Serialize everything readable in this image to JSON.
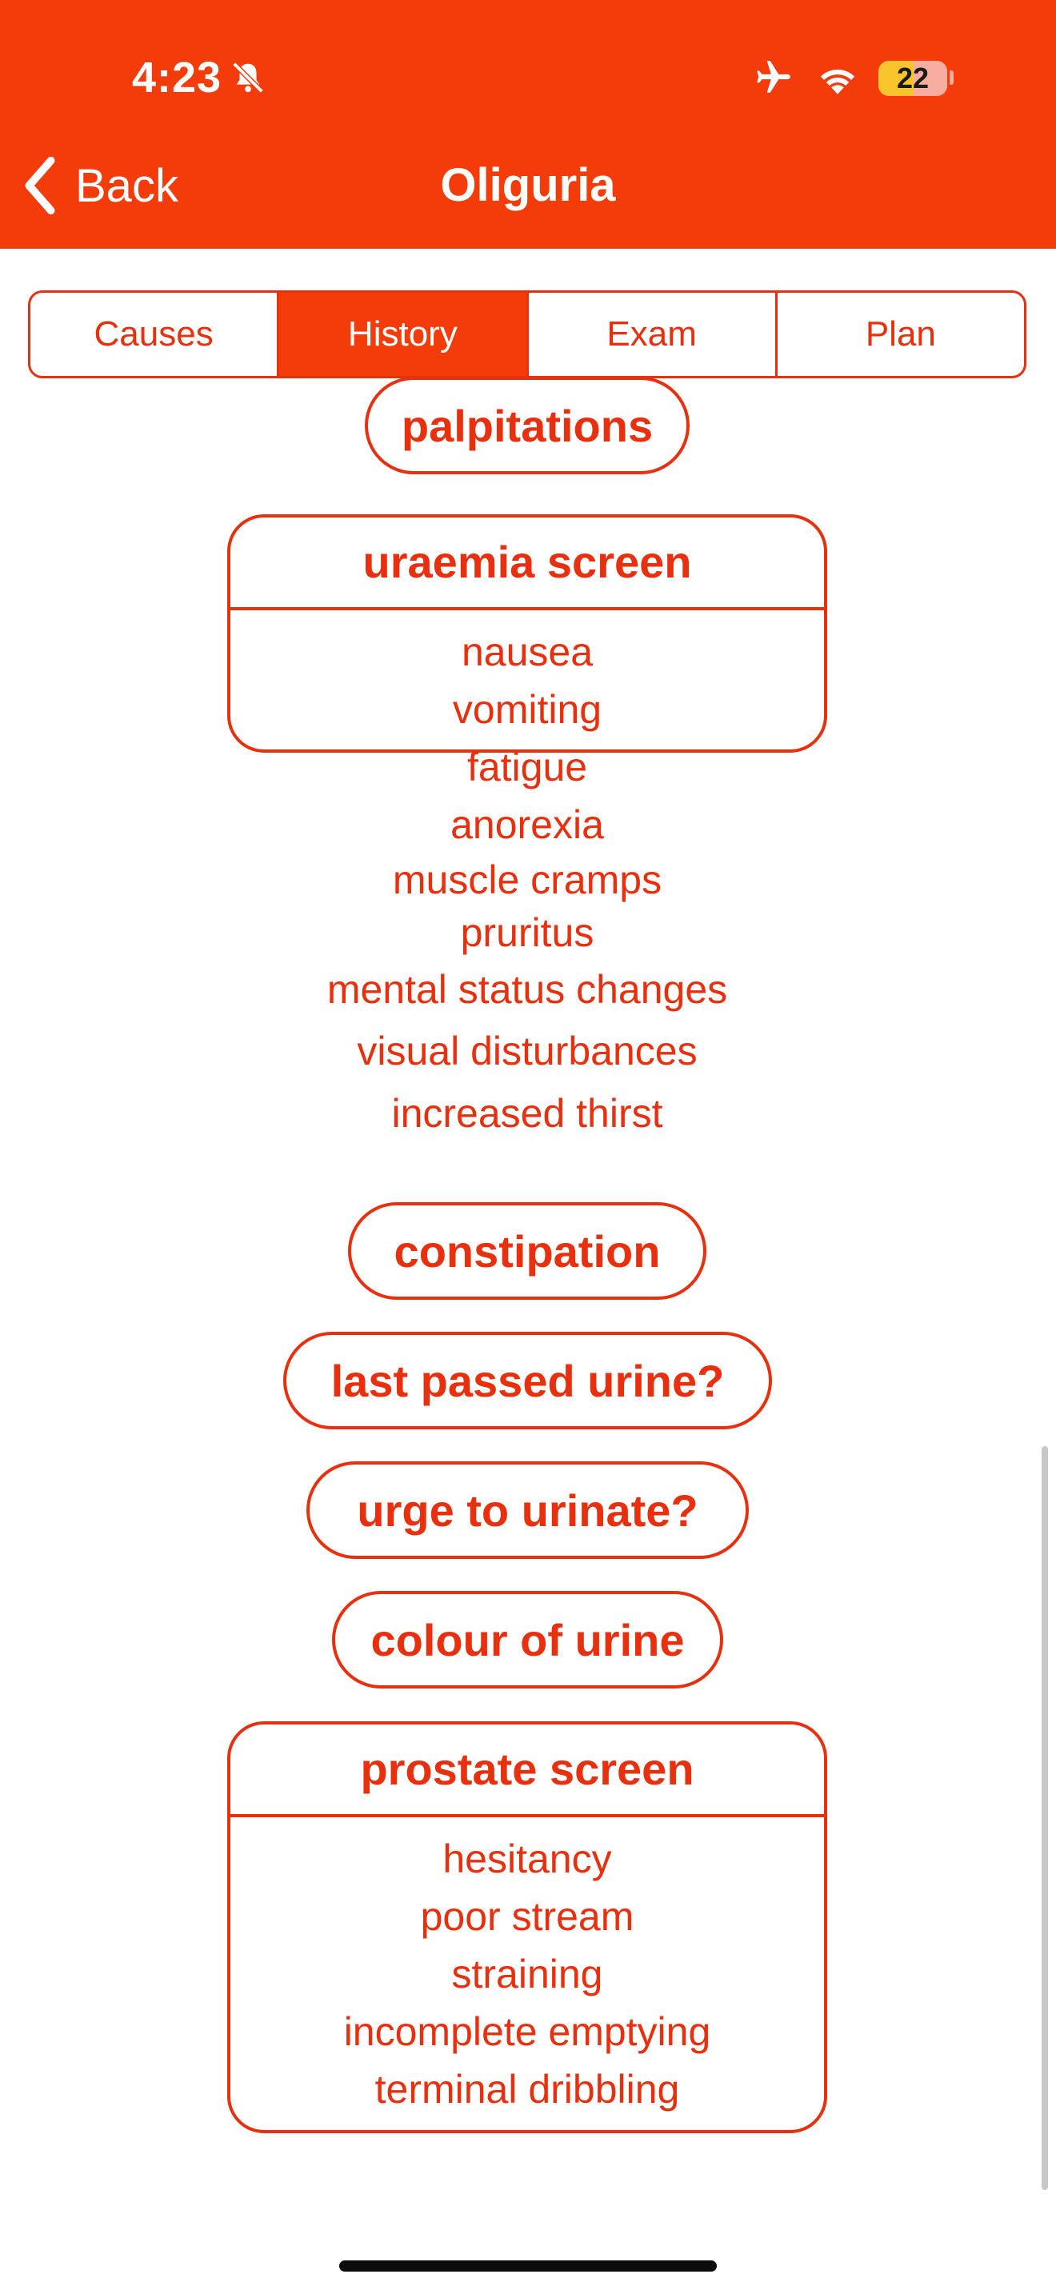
{
  "status_bar": {
    "time": "4:23",
    "battery": "22",
    "icons": [
      "bell-slash-icon",
      "airplane-icon",
      "wifi-icon",
      "battery-icon"
    ]
  },
  "nav": {
    "back_label": "Back",
    "title": "Oliguria"
  },
  "tabs": [
    {
      "label": "Causes",
      "active": false
    },
    {
      "label": "History",
      "active": true
    },
    {
      "label": "Exam",
      "active": false
    },
    {
      "label": "Plan",
      "active": false
    }
  ],
  "history": {
    "palpitations": "palpitations",
    "uraemia": {
      "title": "uraemia screen",
      "items": [
        "nausea",
        "vomiting",
        "fatigue",
        "anorexia",
        "muscle cramps",
        "pruritus",
        "mental status changes",
        "visual disturbances",
        "increased thirst"
      ]
    },
    "constipation": "constipation",
    "last_passed_urine": "last passed urine?",
    "urge_to_urinate": "urge to urinate?",
    "colour_of_urine": "colour of urine",
    "prostate": {
      "title": "prostate screen",
      "items": [
        "hesitancy",
        "poor stream",
        "straining",
        "incomplete emptying",
        "terminal dribbling"
      ]
    }
  },
  "colors": {
    "accent": "#f43c0a",
    "text_accent": "#e8300f",
    "background": "#ffffff"
  }
}
